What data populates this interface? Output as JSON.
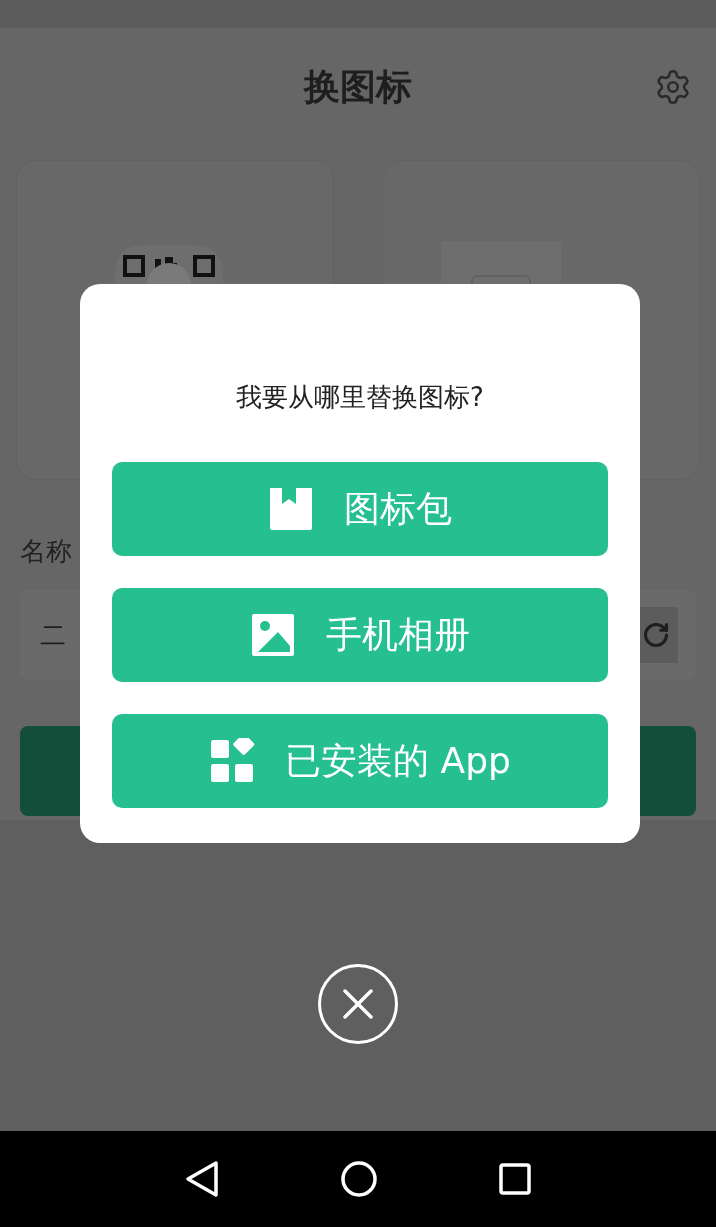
{
  "header": {
    "title": "换图标"
  },
  "cards": [
    {
      "kind": "icon"
    },
    {
      "kind": "placeholder"
    }
  ],
  "name_field": {
    "label": "名称",
    "value": "二"
  },
  "dialog": {
    "question": "我要从哪里替换图标?",
    "options": [
      {
        "kind": "package",
        "label": "图标包"
      },
      {
        "kind": "gallery",
        "label": "手机相册"
      },
      {
        "kind": "apps",
        "label": "已安装的 App"
      }
    ]
  }
}
